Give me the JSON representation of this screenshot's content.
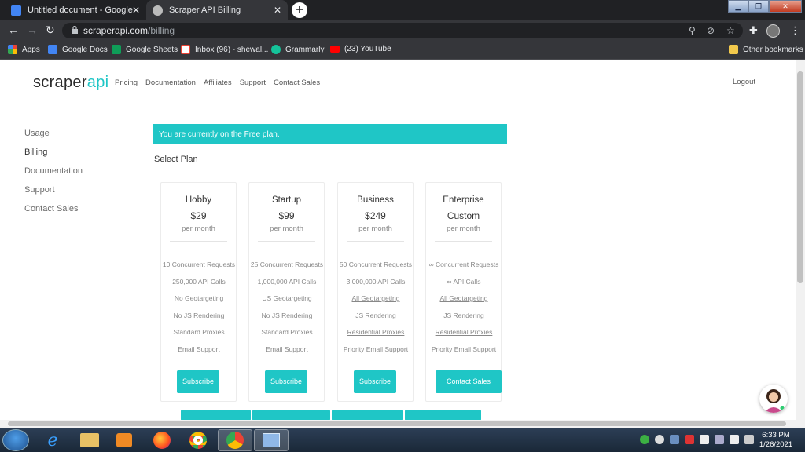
{
  "browser": {
    "tabs": [
      {
        "title": "Untitled document - Google Doc"
      },
      {
        "title": "Scraper API Billing"
      }
    ],
    "url_host": "scraperapi.com",
    "url_path": "/billing",
    "bookmarks": [
      {
        "label": "Apps"
      },
      {
        "label": "Google Docs"
      },
      {
        "label": "Google Sheets"
      },
      {
        "label": "Inbox (96) - shewal..."
      },
      {
        "label": "Grammarly"
      },
      {
        "label": "(23) YouTube"
      }
    ],
    "other_bookmarks": "Other bookmarks"
  },
  "site": {
    "logo_main": "scraper",
    "logo_accent": "api",
    "nav": [
      "Pricing",
      "Documentation",
      "Affiliates",
      "Support",
      "Contact Sales"
    ],
    "logout": "Logout"
  },
  "sidebar": {
    "items": [
      "Usage",
      "Billing",
      "Documentation",
      "Support",
      "Contact Sales"
    ]
  },
  "main": {
    "banner": "You are currently on the Free plan.",
    "select_plan": "Select Plan",
    "plans": [
      {
        "name": "Hobby",
        "price": "$29",
        "period": "per month",
        "features": [
          "10 Concurrent Requests",
          "250,000 API Calls",
          "No Geotargeting",
          "No JS Rendering",
          "Standard Proxies",
          "Email Support"
        ],
        "button": "Subscribe"
      },
      {
        "name": "Startup",
        "price": "$99",
        "period": "per month",
        "features": [
          "25 Concurrent Requests",
          "1,000,000 API Calls",
          "US Geotargeting",
          "No JS Rendering",
          "Standard Proxies",
          "Email Support"
        ],
        "button": "Subscribe"
      },
      {
        "name": "Business",
        "price": "$249",
        "period": "per month",
        "features": [
          "50 Concurrent Requests",
          "3,000,000 API Calls",
          "All Geotargeting",
          "JS Rendering",
          "Residential Proxies",
          "Priority Email Support"
        ],
        "button": "Subscribe"
      },
      {
        "name": "Enterprise",
        "price": "Custom",
        "period": "per month",
        "features": [
          "∞ Concurrent Requests",
          "∞ API Calls",
          "All Geotargeting",
          "JS Rendering",
          "Residential Proxies",
          "Priority Email Support"
        ],
        "button": "Contact Sales"
      }
    ]
  },
  "taskbar": {
    "time": "6:33 PM",
    "date": "1/26/2021"
  },
  "colors": {
    "accent": "#1fc6c6",
    "chrome_dark": "#202124",
    "chrome_toolbar": "#35363a"
  }
}
